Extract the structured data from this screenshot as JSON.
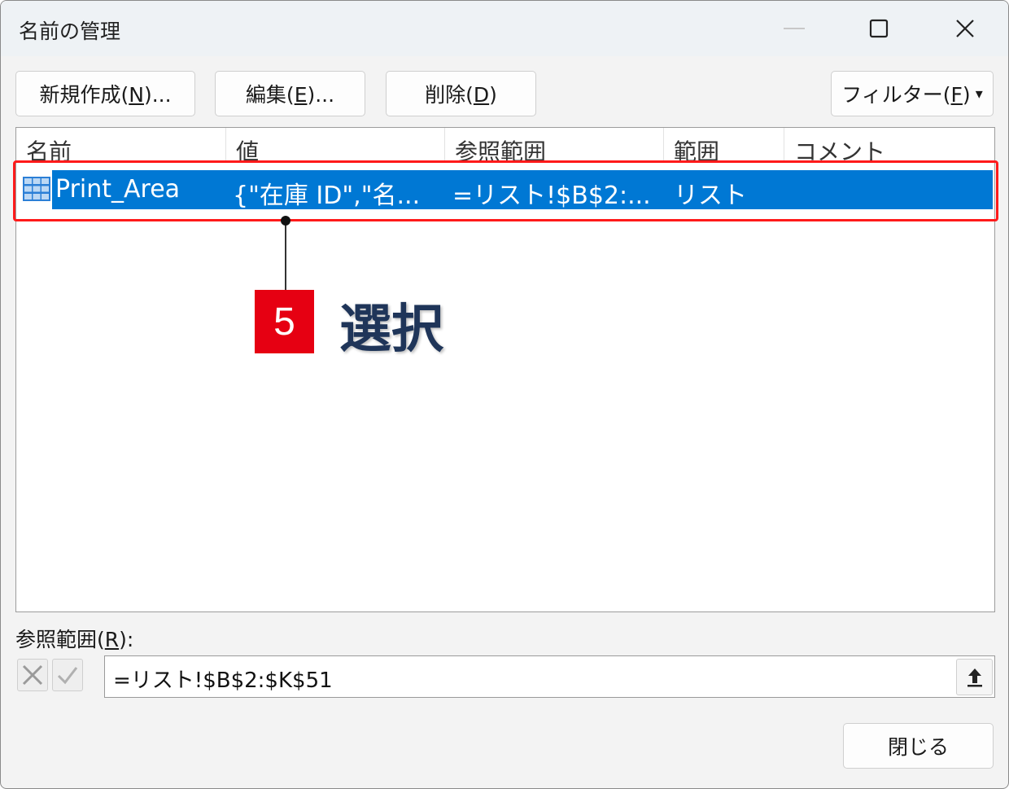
{
  "window": {
    "title": "名前の管理",
    "controls": {
      "minimize": "minimize-icon",
      "maximize": "maximize-icon",
      "close": "close-icon"
    }
  },
  "toolbar": {
    "new_label_pre": "新規作成(",
    "new_key": "N",
    "new_label_post": ")...",
    "edit_label_pre": "編集(",
    "edit_key": "E",
    "edit_label_post": ")...",
    "delete_label_pre": "削除(",
    "delete_key": "D",
    "delete_label_post": ")",
    "filter_label_pre": "フィルター(",
    "filter_key": "F",
    "filter_label_post": ")",
    "filter_arrow": "▾"
  },
  "table": {
    "columns": [
      "名前",
      "値",
      "参照範囲",
      "範囲",
      "コメント"
    ],
    "rows": [
      {
        "name": "Print_Area",
        "value": "{\"在庫 ID\",\"名...",
        "refers_to": "=リスト!$B$2:...",
        "scope": "リスト",
        "comment": "",
        "selected": true,
        "icon": "table-grid-icon"
      }
    ]
  },
  "annotation": {
    "step_number": "5",
    "label": "選択",
    "badge_color": "#e60012",
    "highlight_color": "#ff1a1a"
  },
  "refers_to_field": {
    "label_pre": "参照範囲(",
    "label_key": "R",
    "label_post": "):",
    "value": "=リスト!$B$2:$K$51"
  },
  "footer": {
    "close_label": "閉じる"
  },
  "colors": {
    "selection": "#0078d4",
    "window_bg": "#f3f3f3"
  }
}
